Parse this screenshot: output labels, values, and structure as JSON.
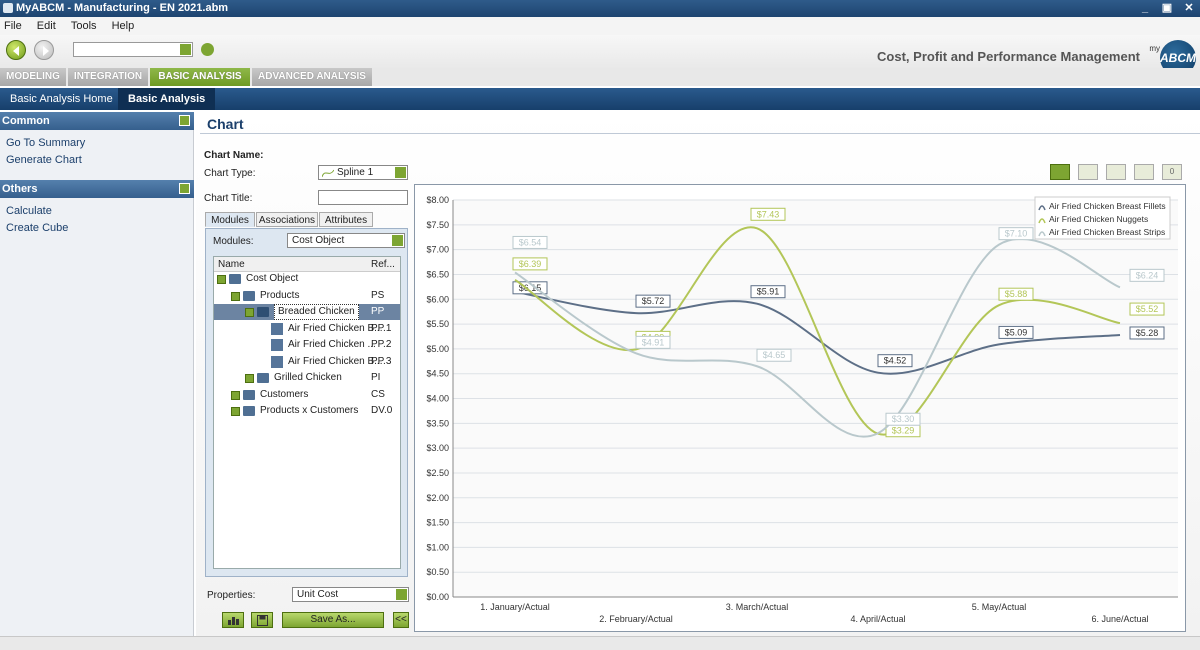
{
  "window": {
    "title": "MyABCM - Manufacturing - EN 2021.abm",
    "minimize": "_",
    "maximize": "▣",
    "close": "✕"
  },
  "menu": [
    "File",
    "Edit",
    "Tools",
    "Help"
  ],
  "header": {
    "tagline": "Cost, Profit and Performance Management",
    "logo_text": "ABCM",
    "logo_prefix": "my"
  },
  "tabs": [
    "MODELING",
    "INTEGRATION",
    "BASIC ANALYSIS",
    "ADVANCED ANALYSIS"
  ],
  "subnav": [
    "Basic Analysis Home",
    "Basic Analysis"
  ],
  "sidebar": {
    "common": {
      "title": "Common",
      "links": [
        "Go To Summary",
        "Generate Chart"
      ]
    },
    "others": {
      "title": "Others",
      "links": [
        "Calculate",
        "Create Cube"
      ]
    }
  },
  "page": {
    "title": "Chart",
    "chart_name_label": "Chart Name:",
    "chart_type_label": "Chart Type:",
    "chart_type_value": "Spline 1",
    "chart_title_label": "Chart Title:",
    "chart_title_value": "",
    "subtabs": [
      "Modules",
      "Associations",
      "Attributes"
    ],
    "modules_label": "Modules:",
    "modules_value": "Cost Object",
    "tree_headers": {
      "name": "Name",
      "ref": "Ref..."
    },
    "tree": [
      {
        "name": "Cost Object",
        "ref": ""
      },
      {
        "name": "Products",
        "ref": "PS"
      },
      {
        "name": "Breaded Chicken",
        "ref": "PP"
      },
      {
        "name": "Air Fried Chicken B...",
        "ref": "PP.1"
      },
      {
        "name": "Air Fried Chicken ...",
        "ref": "PP.2"
      },
      {
        "name": "Air Fried Chicken B...",
        "ref": "PP.3"
      },
      {
        "name": "Grilled Chicken",
        "ref": "PI"
      },
      {
        "name": "Customers",
        "ref": "CS"
      },
      {
        "name": "Products x Customers",
        "ref": "DV.0"
      }
    ],
    "properties_label": "Properties:",
    "properties_value": "Unit Cost",
    "save_as": "Save As...",
    "collapse": "<<",
    "chart_tools": [
      "",
      "",
      "",
      "",
      "0"
    ]
  },
  "chart_data": {
    "type": "line",
    "categories": [
      "1. January/Actual",
      "2. February/Actual",
      "3. March/Actual",
      "4. April/Actual",
      "5. May/Actual",
      "6. June/Actual"
    ],
    "ylim": [
      0,
      8
    ],
    "yticks": [
      "$0.00",
      "$0.50",
      "$1.00",
      "$1.50",
      "$2.00",
      "$2.50",
      "$3.00",
      "$3.50",
      "$4.00",
      "$4.50",
      "$5.00",
      "$5.50",
      "$6.00",
      "$6.50",
      "$7.00",
      "$7.50",
      "$8.00"
    ],
    "grid": true,
    "legend": "top-right",
    "series": [
      {
        "name": "Air Fried Chicken Breast Fillets",
        "color": "#5d6f87",
        "values": [
          6.15,
          5.72,
          5.91,
          4.52,
          5.09,
          5.28
        ],
        "labels": [
          "$6.15",
          "$5.72",
          "$5.91",
          "$4.52",
          "$5.09",
          "$5.28"
        ]
      },
      {
        "name": "Air Fried Chicken Nuggets",
        "color": "#b3c658",
        "values": [
          6.39,
          4.99,
          7.43,
          3.29,
          5.88,
          5.52
        ],
        "labels": [
          "$6.39",
          "$4.99",
          "$7.43",
          "$3.29",
          "$5.88",
          "$5.52"
        ]
      },
      {
        "name": "Air Fried Chicken Breast Strips",
        "color": "#b9c8cc",
        "values": [
          6.54,
          4.91,
          4.65,
          3.3,
          7.1,
          6.24
        ],
        "labels": [
          "$6.54",
          "$4.91",
          "$4.65",
          "$3.30",
          "$7.10",
          "$6.24"
        ]
      }
    ]
  }
}
